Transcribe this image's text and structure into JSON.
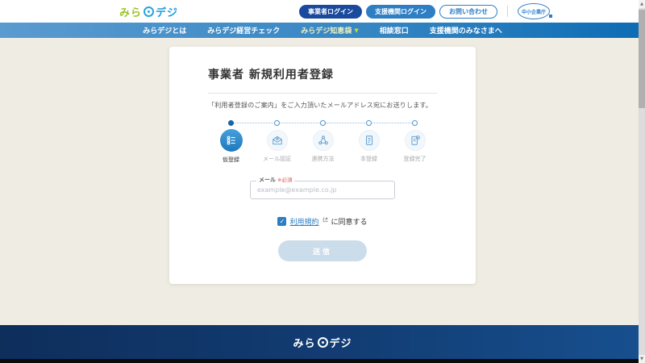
{
  "colors": {
    "brand_green": "#9cc227",
    "brand_blue": "#1e9cd7",
    "nav_blue_left": "#5a9bd0",
    "nav_blue_right": "#0d6cb4",
    "button_dark_blue": "#1a4a9e",
    "button_mid_blue": "#2e7ec4",
    "required_red": "#d9534f",
    "page_background": "#efede3",
    "footer_navy": "#0e2e5c",
    "submit_disabled": "#cbdcea",
    "active_step_blue": "#2f8ccd"
  },
  "header": {
    "logo": {
      "part1": "みら",
      "part2": "デジ"
    },
    "buttons": [
      {
        "label": "事業者ログイン"
      },
      {
        "label": "支援機関ログイン"
      },
      {
        "label": "お問い合わせ"
      }
    ],
    "agency_logo": "中小企業庁"
  },
  "nav": {
    "items": [
      {
        "label": "みらデジとは",
        "highlighted": false,
        "has_dropdown": false
      },
      {
        "label": "みらデジ経営チェック",
        "highlighted": false,
        "has_dropdown": false
      },
      {
        "label": "みらデジ知恵袋",
        "highlighted": true,
        "has_dropdown": true,
        "chevron": "▼"
      },
      {
        "label": "相談窓口",
        "highlighted": false,
        "has_dropdown": false
      },
      {
        "label": "支援機関のみなさまへ",
        "highlighted": false,
        "has_dropdown": false
      }
    ]
  },
  "main": {
    "title": "事業者 新規利用者登録",
    "description": "「利用者登録のご案内」をご入力頂いたメールアドレス宛にお送りします。",
    "steps": [
      {
        "label": "仮登録",
        "icon": "list-icon",
        "active": true
      },
      {
        "label": "メール認証",
        "icon": "mail-icon",
        "active": false
      },
      {
        "label": "連携方法",
        "icon": "share-icon",
        "active": false
      },
      {
        "label": "本登録",
        "icon": "document-icon",
        "active": false
      },
      {
        "label": "登録完了",
        "icon": "document-check-icon",
        "active": false
      }
    ],
    "email_field": {
      "label": "メール",
      "required_mark": "※必須",
      "placeholder": "example@example.co.jp",
      "value": ""
    },
    "terms": {
      "checked": true,
      "checkmark": "✓",
      "link_text": "利用規約",
      "suffix": "に同意する"
    },
    "submit_label": "送信",
    "submit_enabled": false
  },
  "footer": {
    "logo": {
      "part1": "みら",
      "part2": "デジ"
    }
  }
}
